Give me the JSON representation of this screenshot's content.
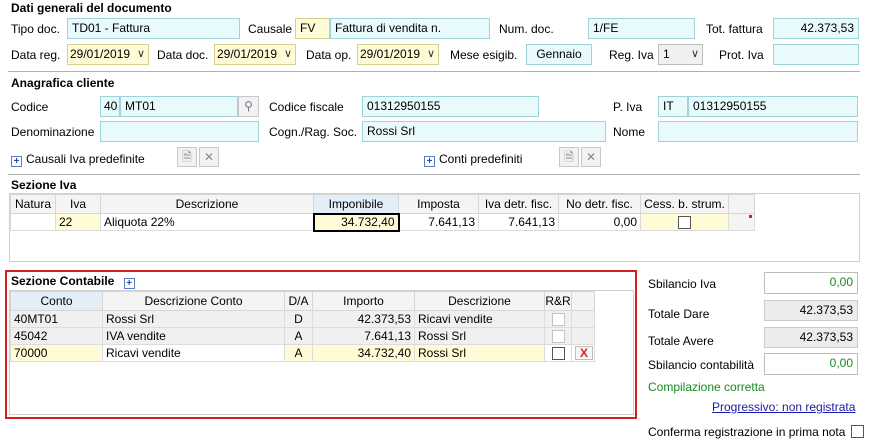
{
  "doc": {
    "title": "Dati generali del documento",
    "tipo_label": "Tipo doc.",
    "tipo_value": "TD01 - Fattura",
    "causale_label": "Causale",
    "causale_code": "FV",
    "causale_desc": "Fattura di vendita n.",
    "num_label": "Num. doc.",
    "num_value": "1/FE",
    "tot_label": "Tot. fattura",
    "tot_value": "42.373,53",
    "datareg_label": "Data reg.",
    "datareg_value": "29/01/2019",
    "datadoc_label": "Data doc.",
    "datadoc_value": "29/01/2019",
    "dataop_label": "Data op.",
    "dataop_value": "29/01/2019",
    "mese_label": "Mese esigib.",
    "mese_value": "Gennaio",
    "regiva_label": "Reg. Iva",
    "regiva_value": "1",
    "prot_label": "Prot. Iva",
    "prot_value": ""
  },
  "cliente": {
    "title": "Anagrafica cliente",
    "codice_label": "Codice",
    "codice_num": "40",
    "codice_value": "MT01",
    "cf_label": "Codice fiscale",
    "cf_value": "01312950155",
    "piva_label": "P. Iva",
    "piva_country": "IT",
    "piva_value": "01312950155",
    "denom_label": "Denominazione",
    "denom_value": "",
    "cogn_label": "Cogn./Rag. Soc.",
    "cogn_value": "Rossi Srl",
    "nome_label": "Nome",
    "nome_value": "",
    "causali_label": "Causali Iva predefinite",
    "conti_label": "Conti predefiniti"
  },
  "iva": {
    "title": "Sezione Iva",
    "headers": [
      "Natura",
      "Iva",
      "Descrizione",
      "Imponibile",
      "Imposta",
      "Iva detr. fisc.",
      "No detr. fisc.",
      "Cess. b. strum."
    ],
    "rows": [
      {
        "natura": "",
        "iva": "22",
        "descrizione": "Aliquota 22%",
        "imponibile": "34.732,40",
        "imposta": "7.641,13",
        "detr": "7.641,13",
        "nodetr": "0,00"
      }
    ]
  },
  "contabile": {
    "title": "Sezione Contabile",
    "headers": [
      "Conto",
      "Descrizione Conto",
      "D/A",
      "Importo",
      "Descrizione",
      "R&R"
    ],
    "rows": [
      {
        "conto": "40MT01",
        "desc_conto": "Rossi Srl",
        "da": "D",
        "importo": "42.373,53",
        "descrizione": "Ricavi vendite"
      },
      {
        "conto": "45042",
        "desc_conto": "IVA vendite",
        "da": "A",
        "importo": "7.641,13",
        "descrizione": "Rossi Srl"
      },
      {
        "conto": "70000",
        "desc_conto": "Ricavi vendite",
        "da": "A",
        "importo": "34.732,40",
        "descrizione": "Rossi Srl"
      }
    ],
    "delete_glyph": "X"
  },
  "riepilogo": {
    "sbil_iva_label": "Sbilancio Iva",
    "sbil_iva_value": "0,00",
    "dare_label": "Totale Dare",
    "dare_value": "42.373,53",
    "avere_label": "Totale Avere",
    "avere_value": "42.373,53",
    "sbil_cont_label": "Sbilancio contabilità",
    "sbil_cont_value": "0,00",
    "status": "Compilazione corretta",
    "progressivo": "Progressivo: non registrata",
    "conferma_label": "Conferma registrazione in prima nota"
  },
  "colors": {
    "field_bg": "#e8fafc",
    "yellow": "#fffbd7",
    "red_box": "#d42020",
    "green": "#178a1f"
  }
}
